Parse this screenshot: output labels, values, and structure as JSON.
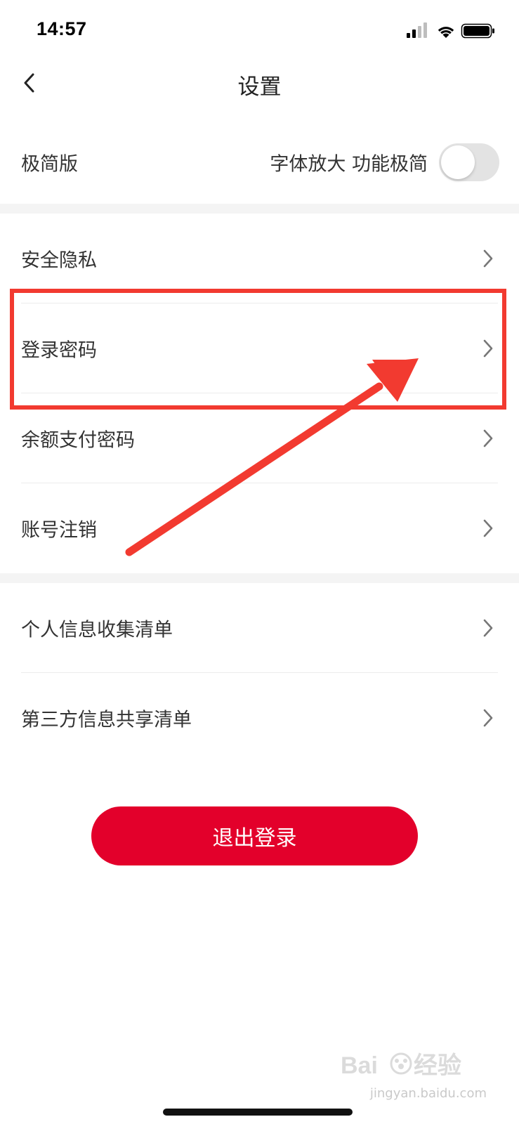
{
  "status_bar": {
    "time": "14:57",
    "icons": [
      "signal-icon",
      "wifi-icon",
      "battery-icon"
    ]
  },
  "nav": {
    "title": "设置",
    "back_icon": "chevron-left-icon"
  },
  "simple_mode": {
    "label": "极简版",
    "hint": "字体放大 功能极简",
    "toggle_on": false
  },
  "section1": {
    "items": [
      {
        "label": "安全隐私"
      },
      {
        "label": "登录密码"
      },
      {
        "label": "余额支付密码"
      },
      {
        "label": "账号注销"
      }
    ]
  },
  "section2": {
    "items": [
      {
        "label": "个人信息收集清单"
      },
      {
        "label": "第三方信息共享清单"
      }
    ]
  },
  "logout": {
    "label": "退出登录"
  },
  "watermark": {
    "brand": "Baidu经验",
    "url": "jingyan.baidu.com"
  },
  "colors": {
    "accent": "#e3002b",
    "annotation": "#f23a30",
    "section_gap": "#f4f4f4"
  }
}
